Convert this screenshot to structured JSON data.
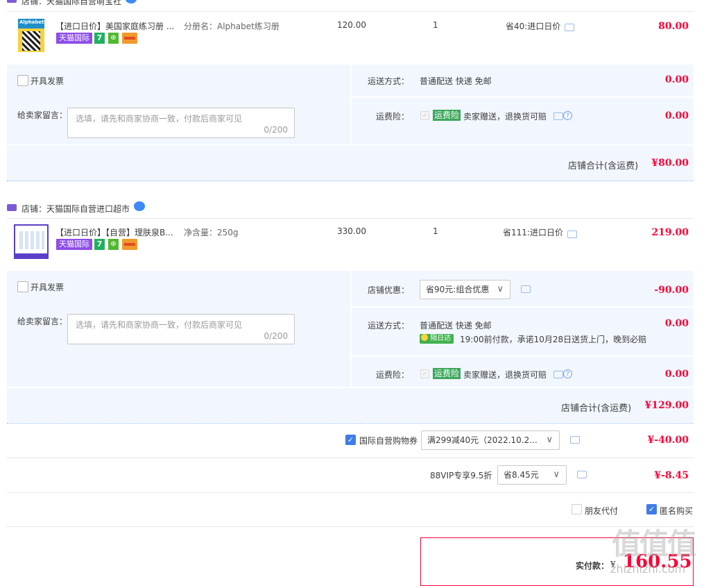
{
  "shop1": {
    "name": "店铺：天猫国际自营萌宝社",
    "item": {
      "title": "【进口日价】美国家庭练习册 ...",
      "sku": "分册名：Alphabet练习册",
      "thumb_text": "Alphabet",
      "badge": "天猫国际",
      "badge_7": "7",
      "unit_price": "120.00",
      "qty": "1",
      "promo": "省40:进口日价",
      "subtotal": "80.00"
    },
    "invoice_label": "开具发票",
    "shipping_label": "运送方式：",
    "shipping_value": "普通配送 快递 免邮",
    "shipping_fee": "0.00",
    "message_label": "给卖家留言：",
    "message_placeholder": "选填，请先和商家协商一致，付款后商家可见",
    "message_count": "0/200",
    "insurance_label": "运费险：",
    "insurance_tag": "运费险",
    "insurance_text": "卖家赠送，退换货可赔",
    "insurance_fee": "0.00",
    "total_label": "店铺合计(含运费)",
    "total_value": "¥80.00"
  },
  "shop2": {
    "name": "店铺：天猫国际自营进口超市",
    "item": {
      "title": "【进口日价】【自营】理肤泉B...",
      "sku": "净含量：250g",
      "badge": "天猫国际",
      "badge_7": "7",
      "unit_price": "330.00",
      "qty": "1",
      "promo": "省111:进口日价",
      "subtotal": "219.00"
    },
    "invoice_label": "开具发票",
    "discount_label": "店铺优惠：",
    "discount_select": "省90元:组合优惠",
    "discount_value": "-90.00",
    "message_label": "给卖家留言：",
    "message_placeholder": "选填，请先和商家协商一致，付款后商家可见",
    "message_count": "0/200",
    "shipping_label": "运送方式：",
    "shipping_value": "普通配送 快递 免邮",
    "delivery_tag": "隔日达",
    "delivery_text": "19:00前付款，承诺10月28日送货上门，晚到必赔",
    "shipping_fee": "0.00",
    "insurance_label": "运费险：",
    "insurance_tag": "运费险",
    "insurance_text": "卖家赠送，退换货可赔",
    "insurance_fee": "0.00",
    "total_label": "店铺合计(含运费)",
    "total_value": "¥129.00"
  },
  "coupon": {
    "label": "国际自营购物券",
    "select": "满299减40元（2022.10.2...",
    "value": "¥-40.00"
  },
  "vip": {
    "label": "88VIP专享9.5折",
    "select": "省8.45元",
    "value": "¥-8.45"
  },
  "options": {
    "friend_pay": "朋友代付",
    "anonymous": "匿名购买"
  },
  "payment": {
    "label": "实付款：",
    "currency": "¥",
    "amount": "160.55"
  },
  "watermark": "值值值",
  "watermark_url": "zhizhizhi.com"
}
